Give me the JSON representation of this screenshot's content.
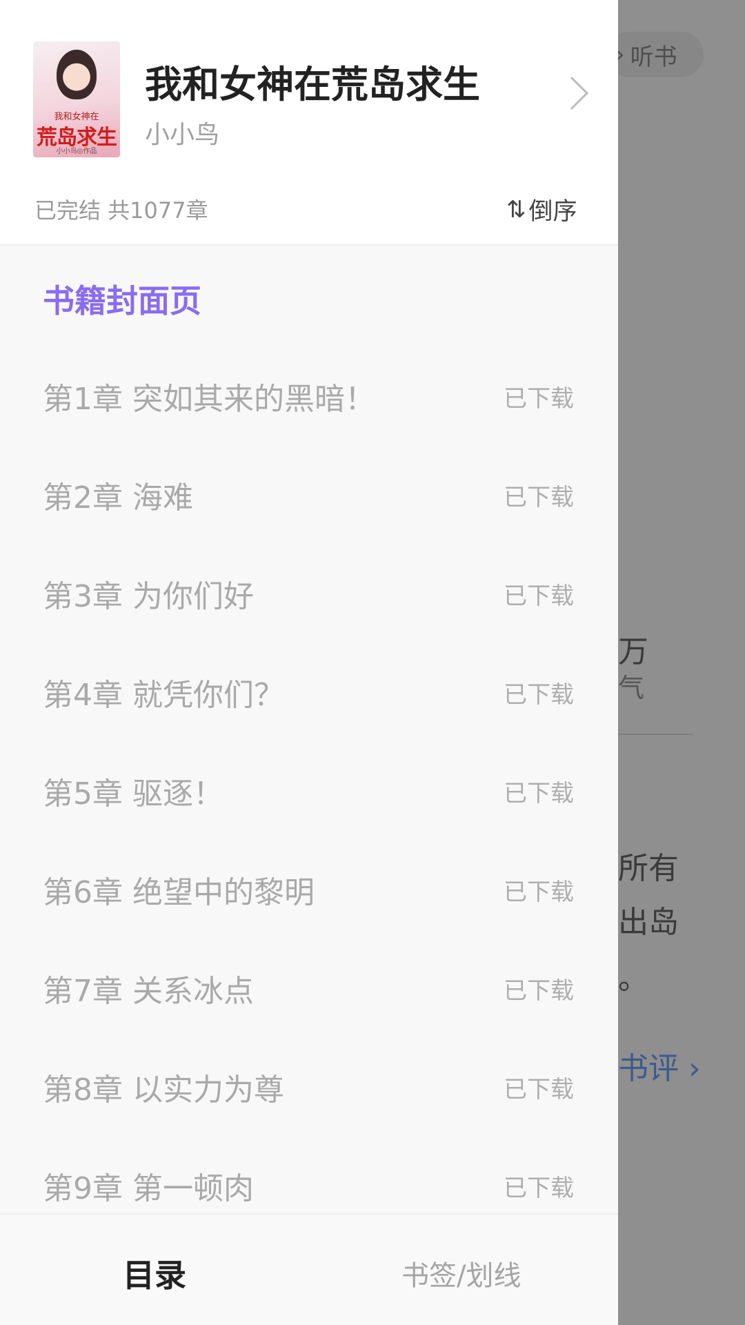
{
  "background": {
    "listen_label": "听书",
    "fragments": [
      "万",
      "气",
      "所有",
      "出岛",
      "。",
      "书评 ›"
    ]
  },
  "book": {
    "title": "我和女神在荒岛求生",
    "author": "小小鸟",
    "status": "已完结 共1077章",
    "cover_text": {
      "top": "我和女神在",
      "main": "荒岛求生",
      "sub": "小小鸟◎作品"
    }
  },
  "sort": {
    "icon": "sort-icon",
    "label": "倒序"
  },
  "cover_page_link": "书籍封面页",
  "chapters": [
    {
      "title": "第1章 突如其来的黑暗！",
      "status": "已下载"
    },
    {
      "title": "第2章 海难",
      "status": "已下载"
    },
    {
      "title": "第3章 为你们好",
      "status": "已下载"
    },
    {
      "title": "第4章 就凭你们？",
      "status": "已下载"
    },
    {
      "title": "第5章 驱逐！",
      "status": "已下载"
    },
    {
      "title": "第6章 绝望中的黎明",
      "status": "已下载"
    },
    {
      "title": "第7章 关系冰点",
      "status": "已下载"
    },
    {
      "title": "第8章 以实力为尊",
      "status": "已下载"
    },
    {
      "title": "第9章 第一顿肉",
      "status": "已下载"
    }
  ],
  "tabs": {
    "catalog": "目录",
    "bookmarks": "书签/划线"
  },
  "colors": {
    "accent": "#8a6cf0",
    "overlay": "#8f8f8f"
  }
}
